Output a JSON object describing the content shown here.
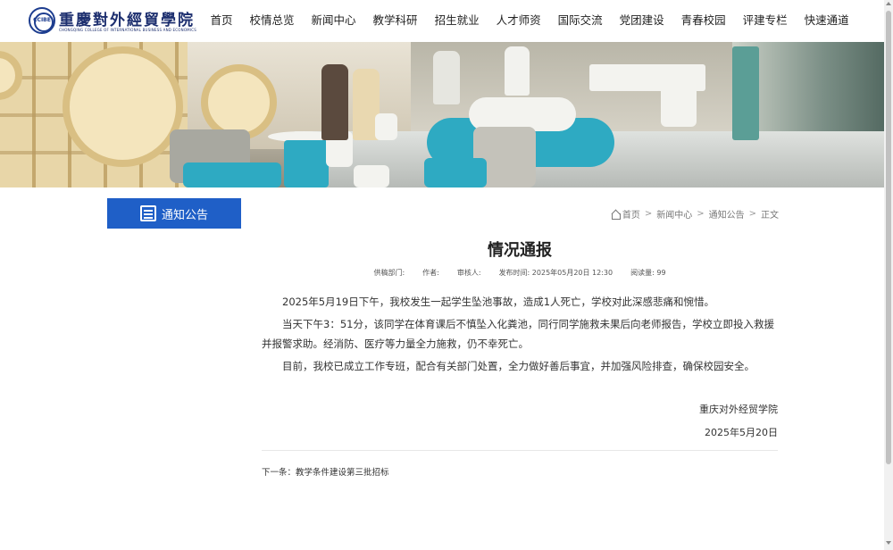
{
  "header": {
    "logo_seal": "CCIBE",
    "logo_cn": "重慶對外經貿學院",
    "logo_en": "CHONGQING COLLEGE OF INTERNATIONAL BUSINESS AND ECONOMICS"
  },
  "nav": [
    {
      "label": "首页"
    },
    {
      "label": "校情总览"
    },
    {
      "label": "新闻中心"
    },
    {
      "label": "教学科研"
    },
    {
      "label": "招生就业"
    },
    {
      "label": "人才师资"
    },
    {
      "label": "国际交流"
    },
    {
      "label": "党团建设"
    },
    {
      "label": "青春校园"
    },
    {
      "label": "评建专栏"
    },
    {
      "label": "快速通道"
    }
  ],
  "sidebar": {
    "category_label": "通知公告"
  },
  "breadcrumb": {
    "home": "首页",
    "level1": "新闻中心",
    "level2": "通知公告",
    "current": "正文",
    "separator": ">"
  },
  "article": {
    "title": "情况通报",
    "meta": {
      "department": "供稿部门:",
      "author": "作者:",
      "reviewer": "审核人:",
      "publish_time": "发布时间: 2025年05月20日 12:30",
      "views": "阅读量: 99"
    },
    "paragraphs": [
      "2025年5月19日下午，我校发生一起学生坠池事故，造成1人死亡，学校对此深感悲痛和惋惜。",
      "当天下午3：51分，该同学在体育课后不慎坠入化粪池，同行同学施救未果后向老师报告，学校立即投入救援并报警求助。经消防、医疗等力量全力施救，仍不幸死亡。",
      "目前，我校已成立工作专班，配合有关部门处置，全力做好善后事宜，并加强风险排查，确保校园安全。"
    ],
    "signature": "重庆对外经贸学院",
    "date": "2025年5月20日"
  },
  "pager": {
    "next": "下一条：教学条件建设第三批招标"
  },
  "colors": {
    "accent": "#1f5fc7",
    "logo": "#1d2f6f"
  }
}
